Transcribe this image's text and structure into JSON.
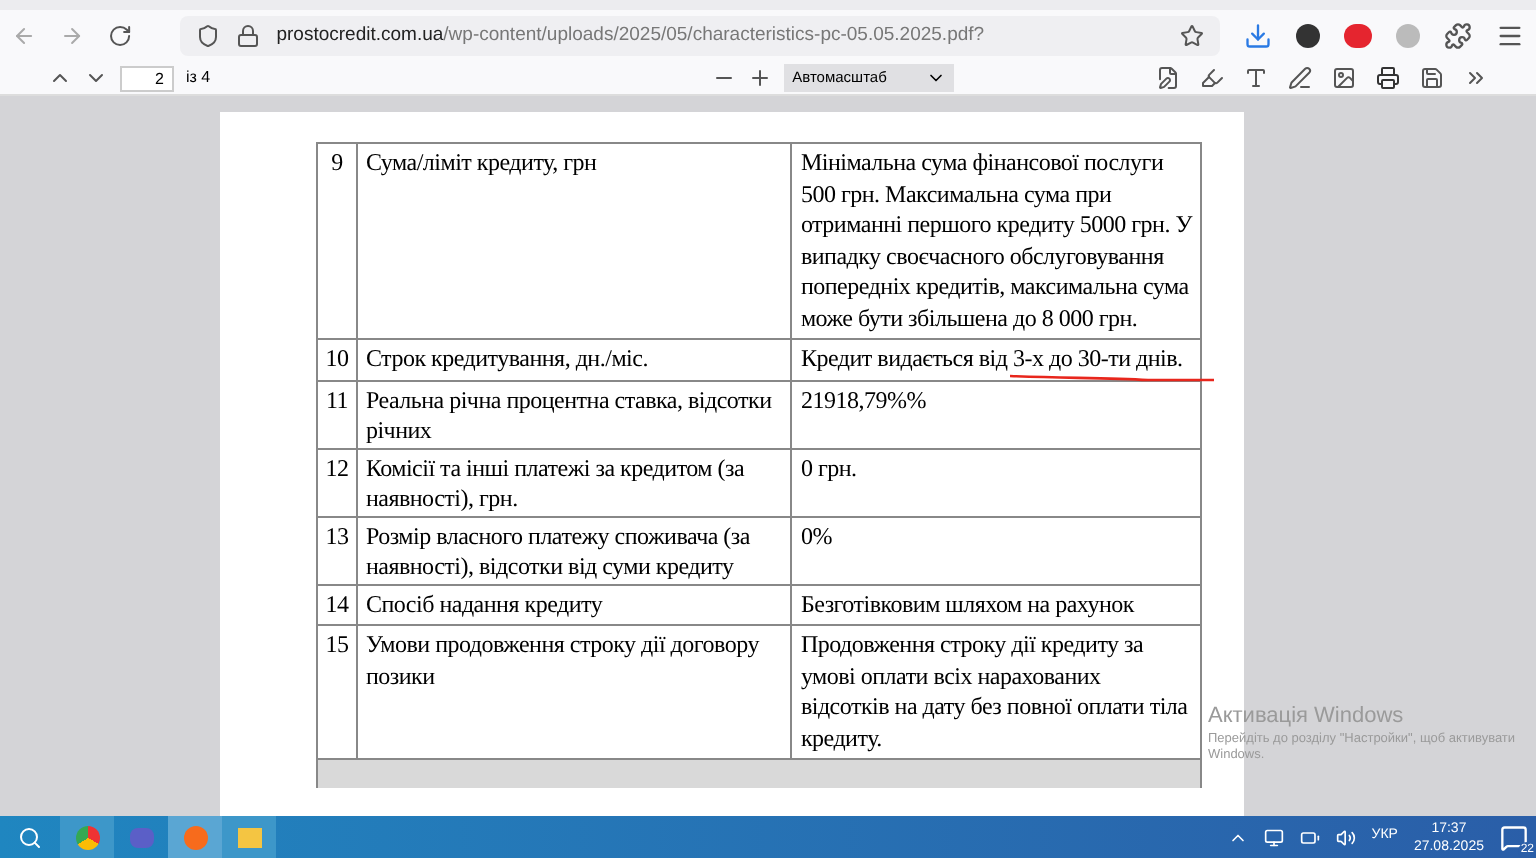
{
  "browser": {
    "url_host": "prostocredit.com.ua",
    "url_path": "/wp-content/uploads/2025/05/characteristics-pc-05.05.2025.pdf?"
  },
  "pdf_toolbar": {
    "page": "2",
    "page_count": "із 4",
    "zoom": "Автомасштаб"
  },
  "table": {
    "rows": [
      {
        "number": "9",
        "label": "Сума/ліміт кредиту, грн",
        "value": "Мінімальна сума фінансової послуги 500 грн. Максимальна сума при отриманні першого кредиту 5000 грн. У випадку своєчасного обслуговування попередніх кредитів, максимальна сума може бути збільшена до 8 000 грн."
      },
      {
        "number": "10",
        "label": "Строк кредитування, дн./міс.",
        "value": "Кредит видається від 3-х до 30-ти днів.",
        "underlined": true
      },
      {
        "number": "11",
        "label": "Реальна річна процентна ставка, відсотки річних",
        "value": "21918,79%%"
      },
      {
        "number": "12",
        "label": "Комісії та інші платежі за кредитом (за наявності), грн.",
        "value": "0 грн."
      },
      {
        "number": "13",
        "label": "Розмір власного платежу споживача (за наявності), відсотки від суми кредиту",
        "value": "0%"
      },
      {
        "number": "14",
        "label": "Спосіб надання кредиту",
        "value": "Безготівковим шляхом на рахунок"
      },
      {
        "number": "15",
        "label": "Умови продовження строку дії договору позики",
        "value": "Продовження строку дії кредиту за умові оплати всіх нарахованих відсотків на дату без повної оплати тіла кредиту."
      }
    ]
  },
  "activation": {
    "title": "Активація Windows",
    "hint": "Перейдіть до розділу \"Настройки\", щоб активувати",
    "hint_2": "Windows."
  },
  "taskbar": {
    "language": "УКР",
    "time": "17:37",
    "date": "27.08.2025",
    "notifications": "22"
  }
}
